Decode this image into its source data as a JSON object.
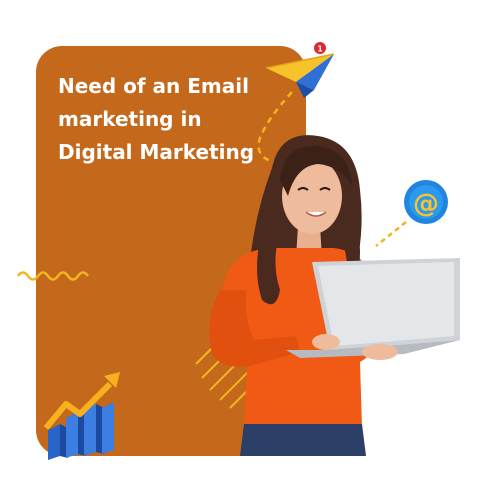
{
  "banner": {
    "headline_lines": [
      "Need of an Email",
      "marketing in",
      "Digital Marketing"
    ],
    "notification_count": "1",
    "email_symbol": "@"
  },
  "icons": {
    "paper_plane": "paper-plane-icon",
    "email_at": "at-sign-icon",
    "growth_chart": "bar-chart-growth-icon",
    "laptop": "laptop-icon"
  },
  "colors": {
    "panel": "#c4681c",
    "headline_text": "#ffffff",
    "accent_yellow": "#f2b51d",
    "plane_blue": "#2f6fd6",
    "at_badge_blue": "#1f86e0",
    "shirt_orange": "#f05a14"
  }
}
